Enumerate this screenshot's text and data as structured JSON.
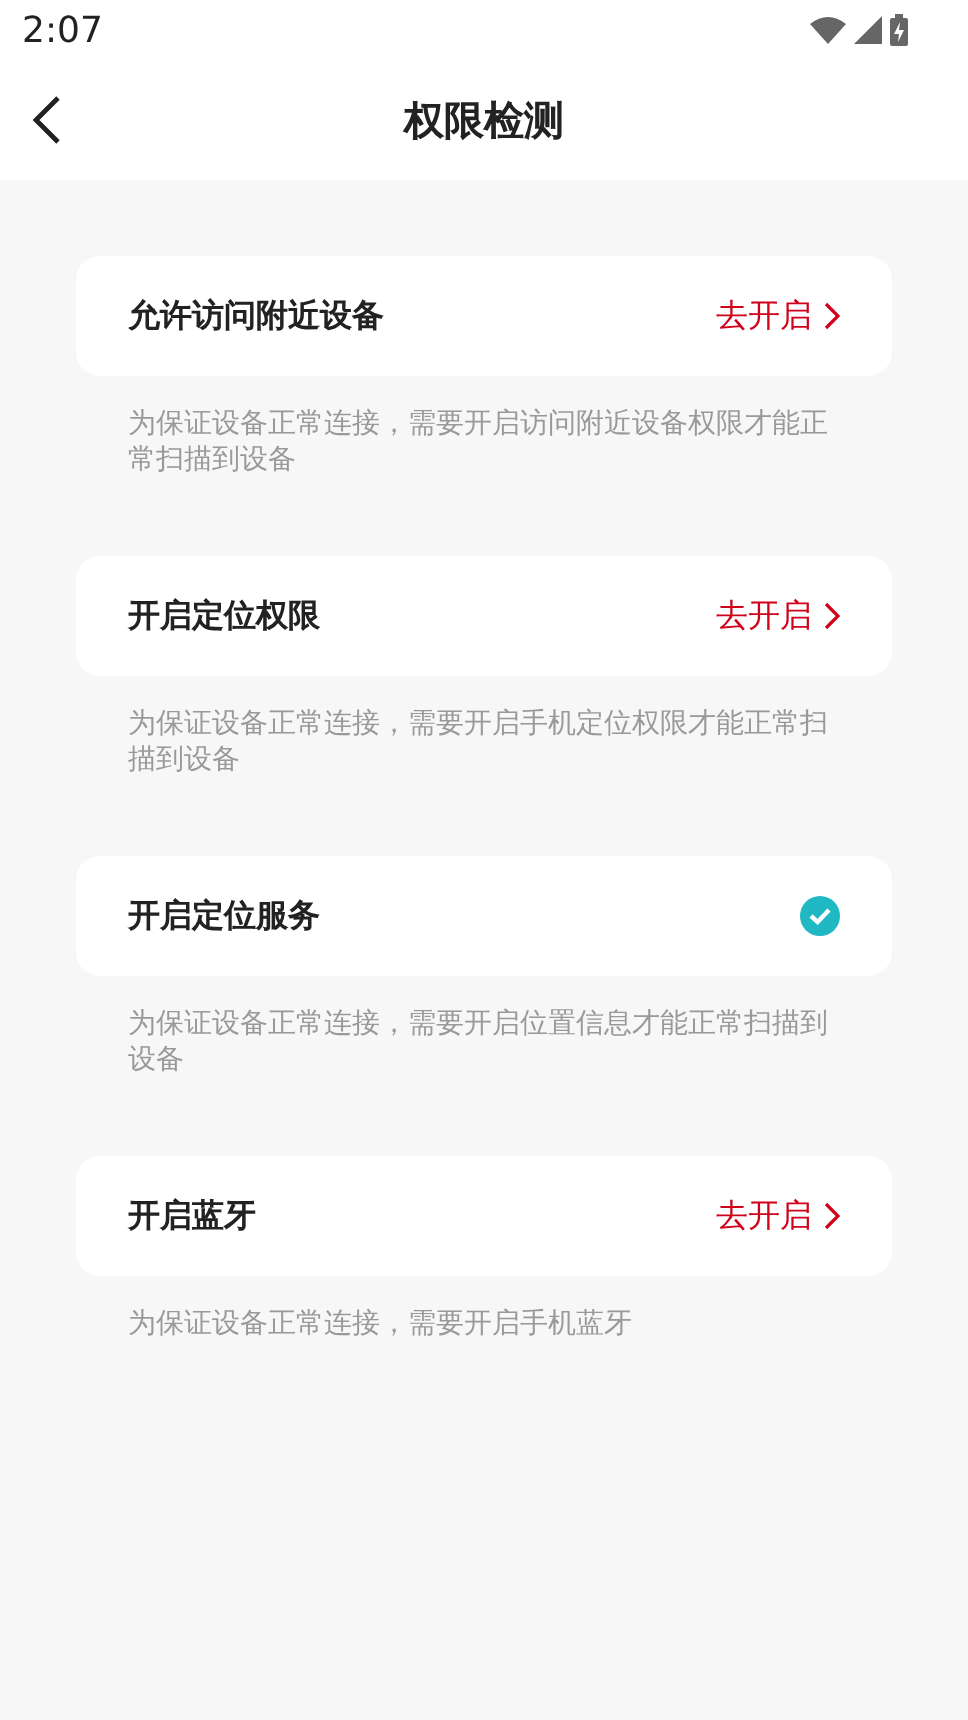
{
  "status_bar": {
    "time": "2:07"
  },
  "header": {
    "title": "权限检测"
  },
  "items": [
    {
      "label": "允许访问附近设备",
      "granted": false,
      "action": "去开启",
      "description": "为保证设备正常连接，需要开启访问附近设备权限才能正常扫描到设备"
    },
    {
      "label": "开启定位权限",
      "granted": false,
      "action": "去开启",
      "description": "为保证设备正常连接，需要开启手机定位权限才能正常扫描到设备"
    },
    {
      "label": "开启定位服务",
      "granted": true,
      "description": "为保证设备正常连接，需要开启位置信息才能正常扫描到设备"
    },
    {
      "label": "开启蓝牙",
      "granted": false,
      "action": "去开启",
      "description": "为保证设备正常连接，需要开启手机蓝牙"
    }
  ]
}
